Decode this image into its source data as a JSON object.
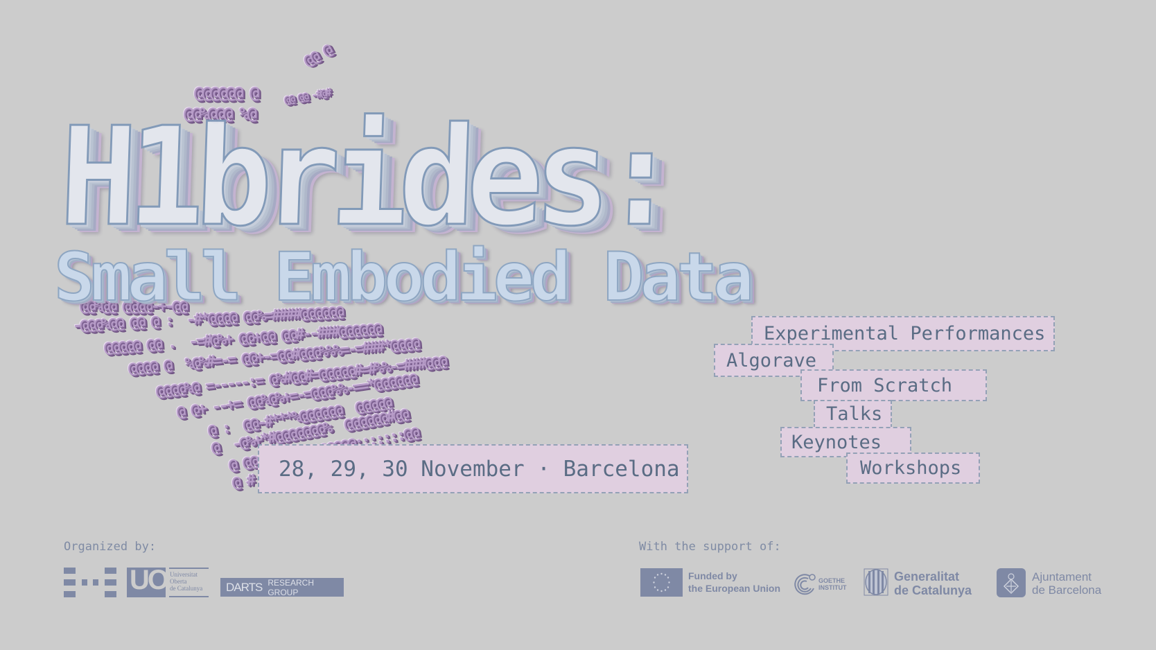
{
  "title": {
    "main": "H1brides:",
    "subtitle": "Small Embodied Data"
  },
  "date_location": "28, 29, 30 November · Barcelona",
  "program": [
    "Experimental Performances",
    "Algorave",
    "From Scratch",
    "Talks",
    "Keynotes",
    "Workshops"
  ],
  "particles": [
    "@@ @",
    "@@@@@@ @",
    "@@%@@@ %@",
    "@@ @@ -#@#",
    "@@%@@ @@@@-+-@@",
    "-@@@%@@ @@ @ :  -#*@@@@ @@%=####@@@@@@",
    "@@@@@ @@ .  -=#@%+ @@+@@ @@#--###@@@@@@",
    "@@@@ @  %@%#=-= @@+-=@@#@@@%%%=-=###*@@@@",
    "@@@@%@ =-----:= @%#@@#=@@@@@#=#%%-=###@@@",
    "@ @+ --+= @@%@%+=-=@@@%%-==*@@@@@@",
    "@ :  @@-#***%@@@@@@  @@@@@",
    "@  -@%+*#@@@@@@@%  @@@@@@#@@",
    "@ @@@@@@@=  @@@@@@:::::::@@",
    "@ # @@@@-  @%#::::::@@"
  ],
  "footer": {
    "organized_label": "Organized by:",
    "organizers": [
      {
        "icon": "dashed-grid-logo",
        "name": ""
      },
      {
        "icon": "uoc-logo",
        "name": "UOC",
        "lines": [
          "Universitat",
          "Oberta",
          "de Catalunya"
        ]
      },
      {
        "icon": "darts-logo",
        "name": "DARTS",
        "suffix": "RESEARCH GROUP"
      }
    ],
    "support_label": "With the support of:",
    "supporters": [
      {
        "icon": "eu-flag-icon",
        "lines": [
          "Funded by",
          "the European Union"
        ]
      },
      {
        "icon": "goethe-logo",
        "lines": [
          "GOETHE",
          "INSTITUT"
        ]
      },
      {
        "icon": "generalitat-logo",
        "lines": [
          "Generalitat",
          "de Catalunya"
        ]
      },
      {
        "icon": "ajuntament-logo",
        "lines": [
          "Ajuntament",
          "de Barcelona"
        ]
      }
    ]
  },
  "colors": {
    "background": "#cccccc",
    "tag_fill": "#e0cfe0",
    "tag_border": "#93a1b6",
    "tag_text": "#5a6c84",
    "logo": "#7f89a5",
    "particle": "#b79cc8"
  }
}
